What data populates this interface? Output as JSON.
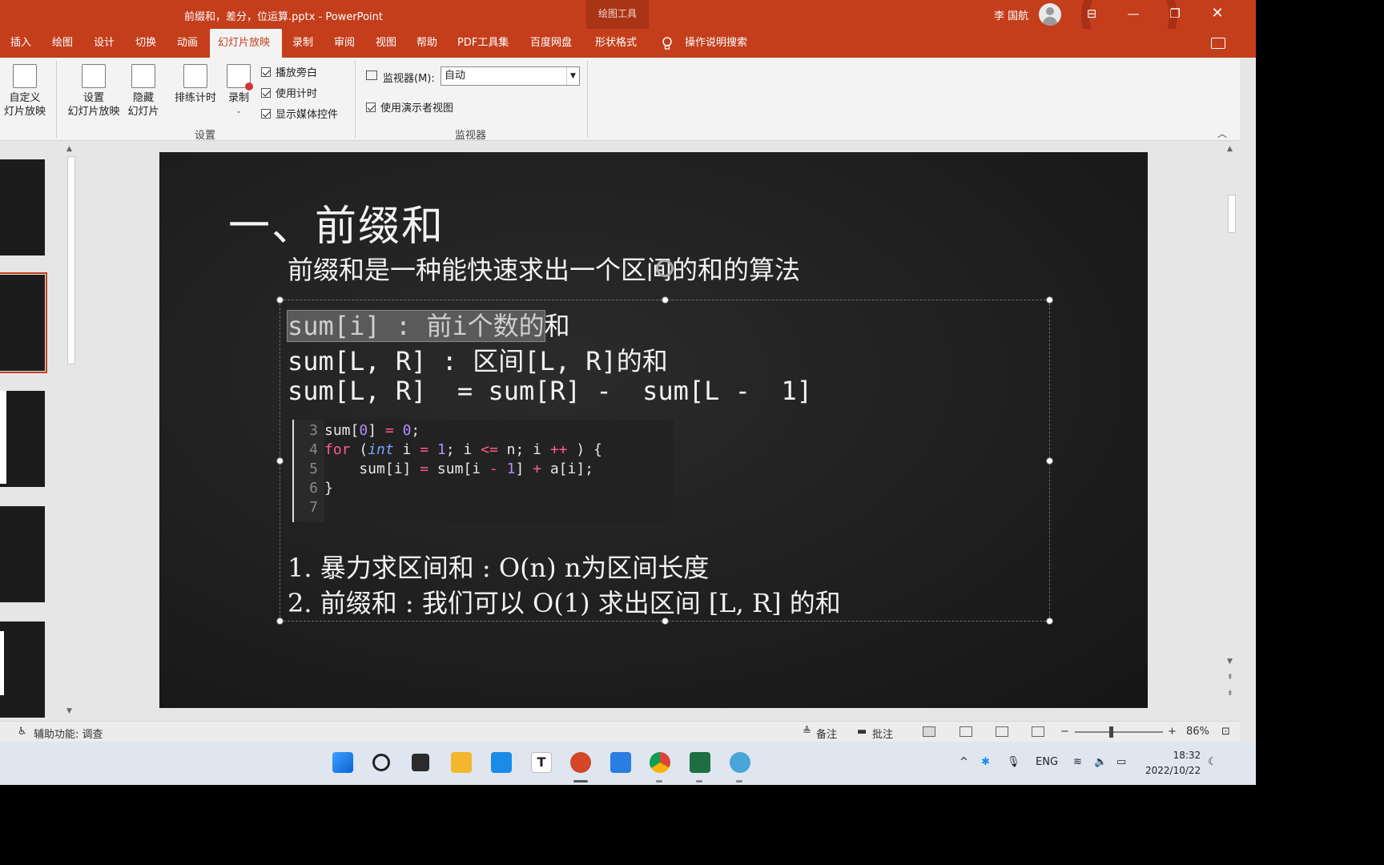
{
  "window": {
    "title": "前缀和，差分，位运算.pptx  -  PowerPoint",
    "contextual_tools": "绘图工具",
    "user": "李 国航"
  },
  "ribbon_tabs": [
    "插入",
    "绘图",
    "设计",
    "切换",
    "动画",
    "幻灯片放映",
    "录制",
    "审阅",
    "视图",
    "帮助",
    "PDF工具集",
    "百度网盘",
    "形状格式"
  ],
  "active_tab": "幻灯片放映",
  "search_label": "操作说明搜索",
  "ribbon": {
    "custom_show": [
      "自定义",
      "灯片放映"
    ],
    "setup_show": [
      "设置",
      "幻灯片放映"
    ],
    "hide_slide": [
      "隐藏",
      "幻灯片"
    ],
    "rehearse": "排练计时",
    "record": "录制",
    "checks": [
      "播放旁白",
      "使用计时",
      "显示媒体控件"
    ],
    "group_setup": "设置",
    "monitor_label": "监视器(M):",
    "monitor_value": "自动",
    "presenter_view": "使用演示者视图",
    "group_monitor": "监视器"
  },
  "slide": {
    "title": "一、前缀和",
    "subtitle": "前缀和是一种能快速求出一个区间的和的算法",
    "line1_selected": "sum[i] : 前i个数的",
    "line1_rest": "和",
    "line2": "sum[L, R] : 区间[L, R]的和",
    "line3": "sum[L, R]  = sum[R] -  sum[L -  1]",
    "code_lines": [
      {
        "ln": "3",
        "tokens": [
          {
            "c": "p",
            "s": "sum["
          },
          {
            "c": "n",
            "s": "0"
          },
          {
            "c": "p",
            "s": "] "
          },
          {
            "c": "o",
            "s": "="
          },
          {
            "c": "p",
            "s": " "
          },
          {
            "c": "n",
            "s": "0"
          },
          {
            "c": "p",
            "s": ";"
          }
        ]
      },
      {
        "ln": "4",
        "tokens": [
          {
            "c": "k",
            "s": "for"
          },
          {
            "c": "p",
            "s": " ("
          },
          {
            "c": "t",
            "s": "int"
          },
          {
            "c": "p",
            "s": " i "
          },
          {
            "c": "o",
            "s": "="
          },
          {
            "c": "p",
            "s": " "
          },
          {
            "c": "n",
            "s": "1"
          },
          {
            "c": "p",
            "s": "; i "
          },
          {
            "c": "o",
            "s": "<="
          },
          {
            "c": "p",
            "s": " n; i "
          },
          {
            "c": "o",
            "s": "++"
          },
          {
            "c": "p",
            "s": " ) {"
          }
        ]
      },
      {
        "ln": "5",
        "tokens": [
          {
            "c": "p",
            "s": "    sum[i] "
          },
          {
            "c": "o",
            "s": "="
          },
          {
            "c": "p",
            "s": " sum[i "
          },
          {
            "c": "o",
            "s": "-"
          },
          {
            "c": "p",
            "s": " "
          },
          {
            "c": "n",
            "s": "1"
          },
          {
            "c": "p",
            "s": "] "
          },
          {
            "c": "o",
            "s": "+"
          },
          {
            "c": "p",
            "s": " a[i];"
          }
        ]
      },
      {
        "ln": "6",
        "tokens": [
          {
            "c": "p",
            "s": "}"
          }
        ]
      },
      {
        "ln": "7",
        "tokens": []
      }
    ],
    "point1": "1.  暴力求区间和 : O(n)  n为区间长度",
    "point2": "2.  前缀和 : 我们可以 O(1) 求出区间 [L, R] 的和"
  },
  "status": {
    "accessibility": "辅助功能: 调查",
    "notes": "备注",
    "comments": "批注",
    "zoom": "86%",
    "zoom_level": 0.86
  },
  "taskbar": {
    "lang": "ENG",
    "time": "18:32",
    "date": "2022/10/22",
    "icons": [
      "windows-start-icon",
      "search-icon",
      "task-view-icon",
      "file-explorer-icon",
      "app-store-icon",
      "typora-icon",
      "powerpoint-icon",
      "photos-icon",
      "chrome-icon",
      "excel-icon",
      "network-app-icon"
    ]
  }
}
